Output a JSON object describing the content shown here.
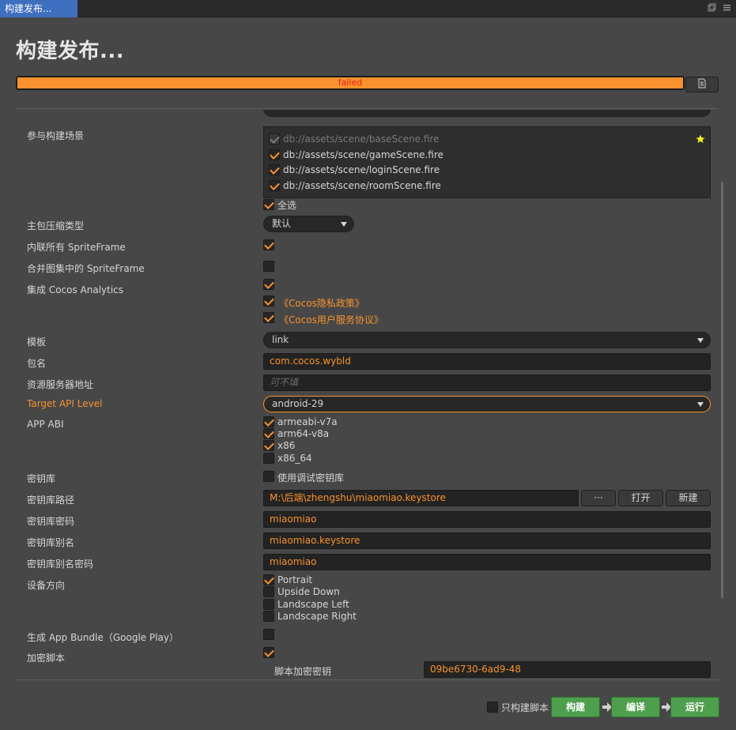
{
  "window": {
    "tab_title": "构建发布...",
    "page_title": "构建发布..."
  },
  "progress": {
    "status_text": "failed",
    "percent": 100
  },
  "scenes": {
    "label": "参与构建场景",
    "items": [
      {
        "path": "db://assets/scene/baseScene.fire",
        "checked": true,
        "disabled": true
      },
      {
        "path": "db://assets/scene/gameScene.fire",
        "checked": true
      },
      {
        "path": "db://assets/scene/loginScene.fire",
        "checked": true
      },
      {
        "path": "db://assets/scene/roomScene.fire",
        "checked": true
      }
    ],
    "select_all_label": "全选"
  },
  "compress": {
    "label": "主包压缩类型",
    "value": "默认"
  },
  "inline_sprite": {
    "label": "内联所有 SpriteFrame"
  },
  "merge_sprite": {
    "label": "合并图集中的 SpriteFrame"
  },
  "analytics": {
    "label": "集成 Cocos Analytics",
    "privacy_link": "《Cocos隐私政策》",
    "service_link": "《Cocos用户服务协议》"
  },
  "template": {
    "label": "模板",
    "value": "link"
  },
  "package_name": {
    "label": "包名",
    "value": "com.cocos.wybld"
  },
  "resource_server": {
    "label": "资源服务器地址",
    "placeholder": "可不填"
  },
  "api_level": {
    "label": "Target API Level",
    "value": "android-29"
  },
  "abi": {
    "label": "APP ABI",
    "options": [
      {
        "name": "armeabi-v7a",
        "checked": true
      },
      {
        "name": "arm64-v8a",
        "checked": true
      },
      {
        "name": "x86",
        "checked": true
      },
      {
        "name": "x86_64",
        "checked": false
      }
    ]
  },
  "keystore": {
    "label": "密钥库",
    "debug_label": "使用调试密钥库",
    "path_label": "密钥库路径",
    "path_value": "M:\\后端\\zhengshu\\miaomiao.keystore",
    "browse_label": "···",
    "open_label": "打开",
    "new_label": "新建",
    "password_label": "密钥库密码",
    "password_value": "miaomiao",
    "alias_label": "密钥库别名",
    "alias_value": "miaomiao.keystore",
    "alias_password_label": "密钥库别名密码",
    "alias_password_value": "miaomiao"
  },
  "orientation": {
    "label": "设备方向",
    "options": [
      {
        "name": "Portrait",
        "checked": true
      },
      {
        "name": "Upside Down",
        "checked": false
      },
      {
        "name": "Landscape Left",
        "checked": false
      },
      {
        "name": "Landscape Right",
        "checked": false
      }
    ]
  },
  "app_bundle": {
    "label": "生成 App Bundle（Google Play）"
  },
  "encrypt": {
    "label": "加密脚本",
    "key_label": "脚本加密密钥",
    "key_value": "09be6730-6ad9-48"
  },
  "footer": {
    "script_only_label": "只构建脚本",
    "build_label": "构建",
    "compile_label": "编译",
    "run_label": "运行"
  },
  "colors": {
    "accent": "#f7922d",
    "error": "#e7201a",
    "green": "#4e9f4d",
    "tab": "#3e6fbf"
  }
}
